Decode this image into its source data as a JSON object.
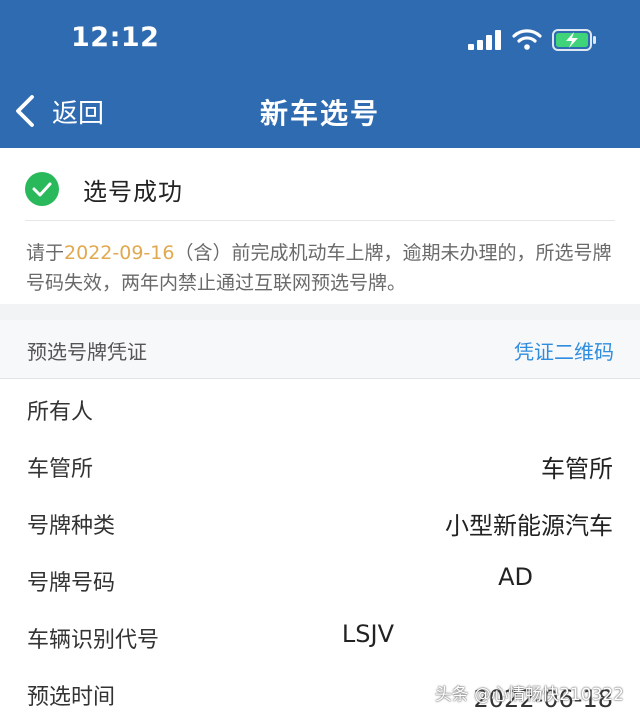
{
  "status_bar": {
    "time": "12:12"
  },
  "nav": {
    "back_label": "返回",
    "title": "新车选号"
  },
  "success": {
    "text": "选号成功"
  },
  "notice": {
    "prefix": "请于",
    "date": "2022-09-16",
    "suffix": "（含）前完成机动车上牌，逾期未办理的，所选号牌号码失效，两年内禁止通过互联网预选号牌。"
  },
  "voucher": {
    "title": "预选号牌凭证",
    "qr_link": "凭证二维码",
    "rows": [
      {
        "label": "所有人",
        "value": ""
      },
      {
        "label": "车管所",
        "value": "车管所"
      },
      {
        "label": "号牌种类",
        "value": "小型新能源汽车"
      },
      {
        "label": "号牌号码",
        "value": "AD"
      },
      {
        "label": "车辆识别代号",
        "value": "LSJV"
      },
      {
        "label": "预选时间",
        "value": "2022-06-18"
      }
    ]
  },
  "watermark": "头条 @心情畅快210322",
  "colors": {
    "header": "#2e6bb1",
    "success": "#29b85a",
    "date": "#e0a94f",
    "link": "#2f8de0"
  },
  "icons": [
    "signal-icon",
    "wifi-icon",
    "battery-charging-icon",
    "back-chevron-icon",
    "check-icon"
  ]
}
